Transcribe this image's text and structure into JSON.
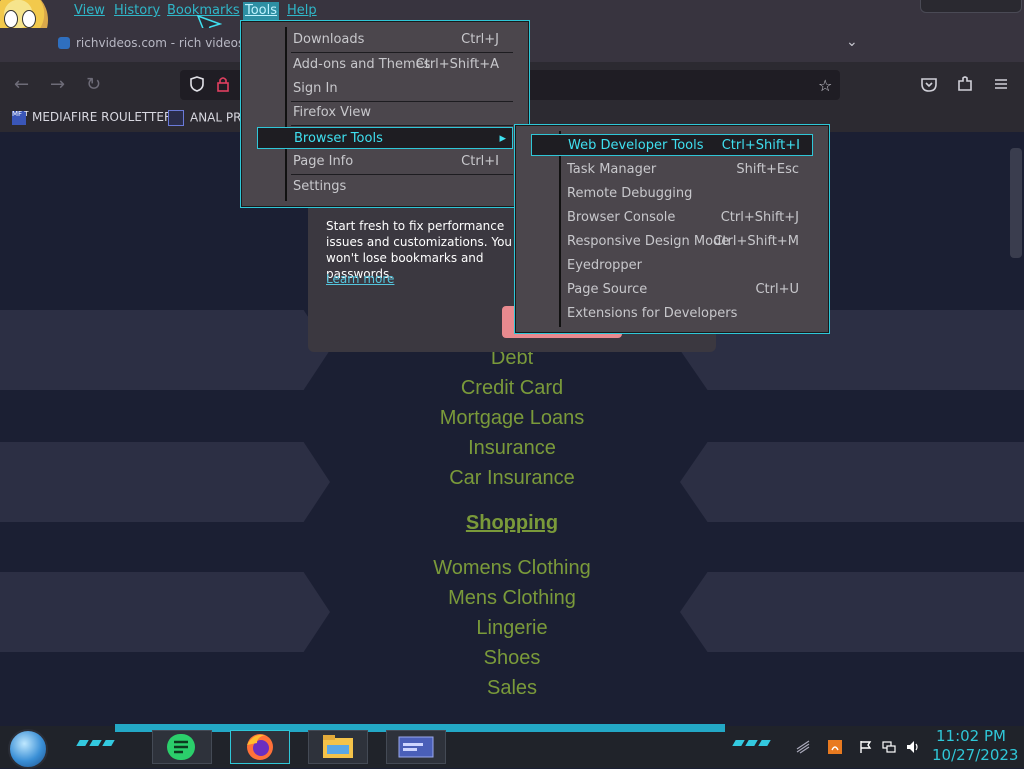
{
  "menubar": [
    "View",
    "History",
    "Bookmarks",
    "Tools",
    "Help"
  ],
  "tab": {
    "title": "richvideos.com - rich videos Re"
  },
  "bookmarks": [
    {
      "label": "MEDIAFIRE ROULETTER",
      "icon_text": "MF T"
    },
    {
      "label": "ANAL PRO"
    }
  ],
  "popup": {
    "text": "Start fresh to fix performance issues and customizations. You won't lose bookmarks and passwords.",
    "link": "Learn more"
  },
  "tools_menu": [
    {
      "label": "Downloads",
      "shortcut": "Ctrl+J"
    },
    {
      "label": "Add-ons and Themes",
      "shortcut": "Ctrl+Shift+A"
    },
    {
      "label": "Sign In",
      "shortcut": ""
    },
    {
      "label": "Firefox View",
      "shortcut": ""
    },
    {
      "label": "Browser Tools",
      "shortcut": "▸"
    },
    {
      "label": "Page Info",
      "shortcut": "Ctrl+I"
    },
    {
      "label": "Settings",
      "shortcut": ""
    }
  ],
  "browser_tools_menu": [
    {
      "label": "Web Developer Tools",
      "shortcut": "Ctrl+Shift+I"
    },
    {
      "label": "Task Manager",
      "shortcut": "Shift+Esc"
    },
    {
      "label": "Remote Debugging",
      "shortcut": ""
    },
    {
      "label": "Browser Console",
      "shortcut": "Ctrl+Shift+J"
    },
    {
      "label": "Responsive Design Mode",
      "shortcut": "Ctrl+Shift+M"
    },
    {
      "label": "Eyedropper",
      "shortcut": ""
    },
    {
      "label": "Page Source",
      "shortcut": "Ctrl+U"
    },
    {
      "label": "Extensions for Developers",
      "shortcut": ""
    }
  ],
  "page_links": {
    "finance": [
      "Debt",
      "Credit Card",
      "Mortgage Loans",
      "Insurance",
      "Car Insurance"
    ],
    "shopping_heading": "Shopping",
    "shopping": [
      "Womens Clothing",
      "Mens Clothing",
      "Lingerie",
      "Shoes",
      "Sales"
    ]
  },
  "clock": {
    "time": "11:02 PM",
    "date": "10/27/2023"
  },
  "colors": {
    "accent": "#2fc7d8",
    "link_green": "#7a9a3a",
    "menu_bg": "#4b464c"
  }
}
